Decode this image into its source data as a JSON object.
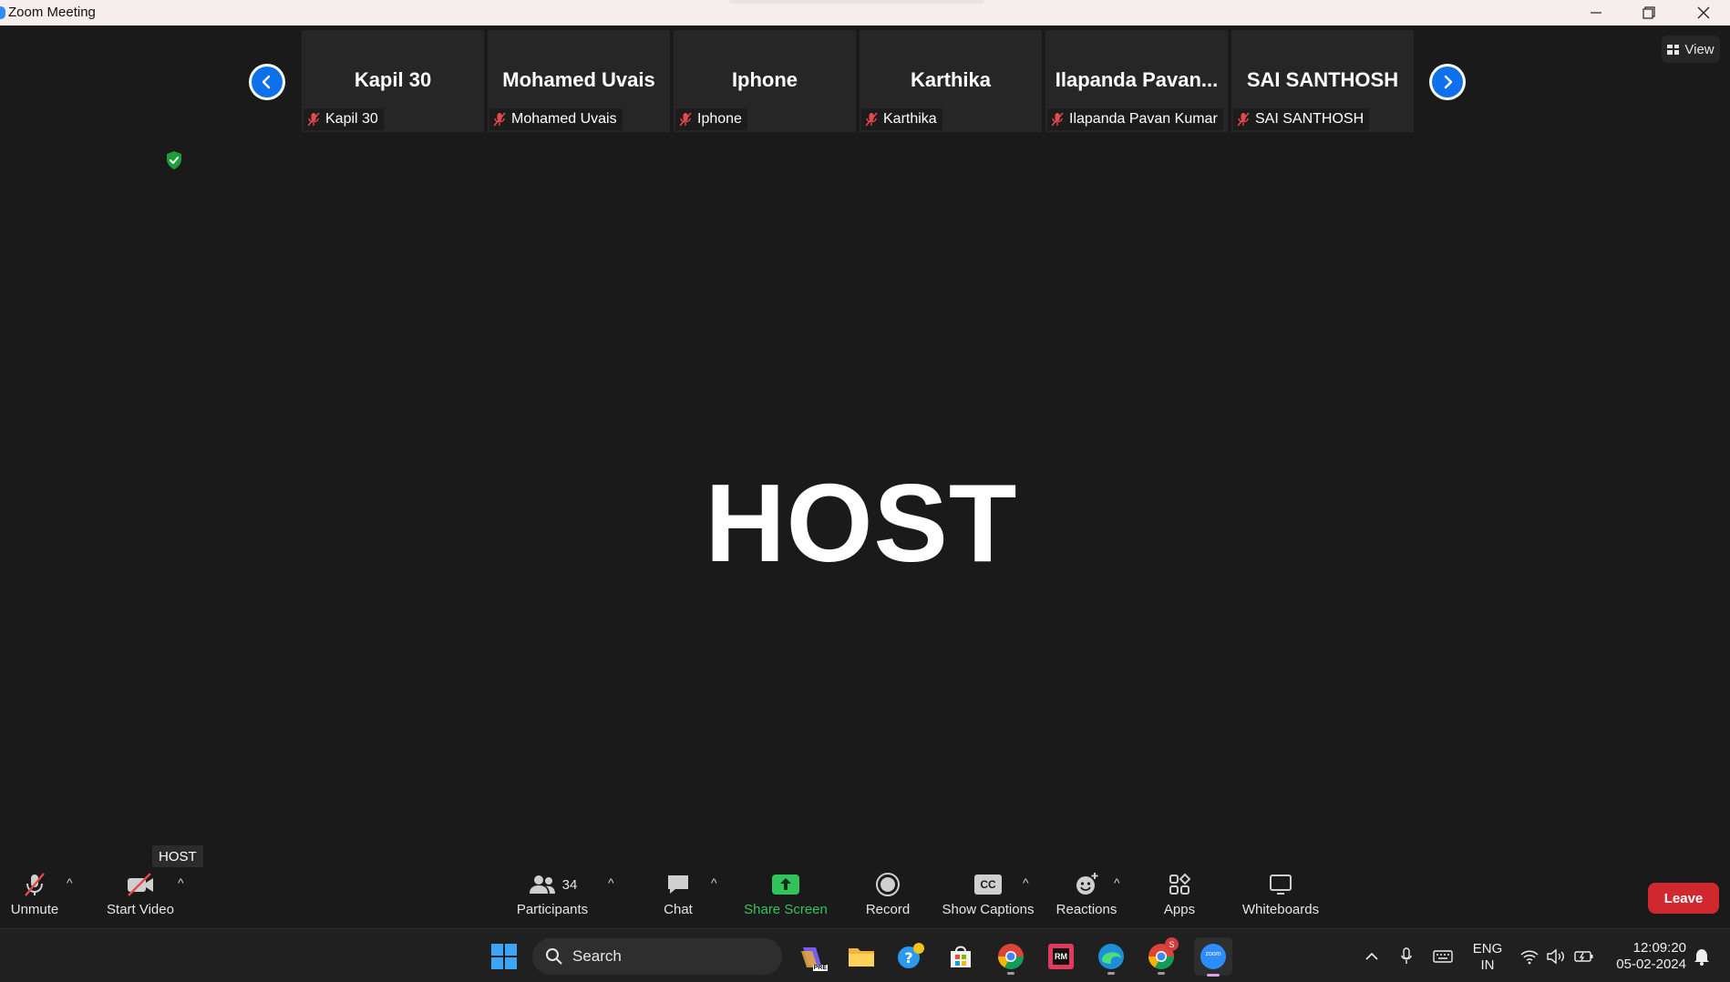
{
  "window": {
    "title": "Zoom Meeting",
    "controls": {
      "minimize": "—",
      "restore": "❐",
      "close": "✕"
    }
  },
  "stage": {
    "view_label": "View",
    "main_speaker": "HOST",
    "participants_strip": [
      {
        "display": "Kapil 30",
        "label": "Kapil 30",
        "muted": true
      },
      {
        "display": "Mohamed Uvais",
        "label": "Mohamed Uvais",
        "muted": true
      },
      {
        "display": "Iphone",
        "label": "Iphone",
        "muted": true
      },
      {
        "display": "Karthika",
        "label": "Karthika",
        "muted": true
      },
      {
        "display": "Ilapanda  Pavan...",
        "label": "Ilapanda Pavan Kumar",
        "muted": true
      },
      {
        "display": "SAI SANTHOSH",
        "label": "SAI SANTHOSH",
        "muted": true
      }
    ]
  },
  "toolbar": {
    "host_tooltip": "HOST",
    "unmute": "Unmute",
    "start_video": "Start Video",
    "participants": "Participants",
    "participant_count": "34",
    "chat": "Chat",
    "share_screen": "Share Screen",
    "record": "Record",
    "show_captions": "Show Captions",
    "captions_badge": "CC",
    "reactions": "Reactions",
    "apps": "Apps",
    "whiteboards": "Whiteboards",
    "leave": "Leave"
  },
  "taskbar": {
    "search_placeholder": "Search",
    "copilot_badge": "PRE",
    "rm_badge": "RM",
    "chrome_badge": "S",
    "zoom_label": "zoom",
    "language_line1": "ENG",
    "language_line2": "IN",
    "time": "12:09:20",
    "date": "05-02-2024"
  },
  "colors": {
    "accent_blue": "#0e71eb",
    "share_green": "#32c45a",
    "leave_red": "#d0282e",
    "muted_red": "#e5484d"
  }
}
